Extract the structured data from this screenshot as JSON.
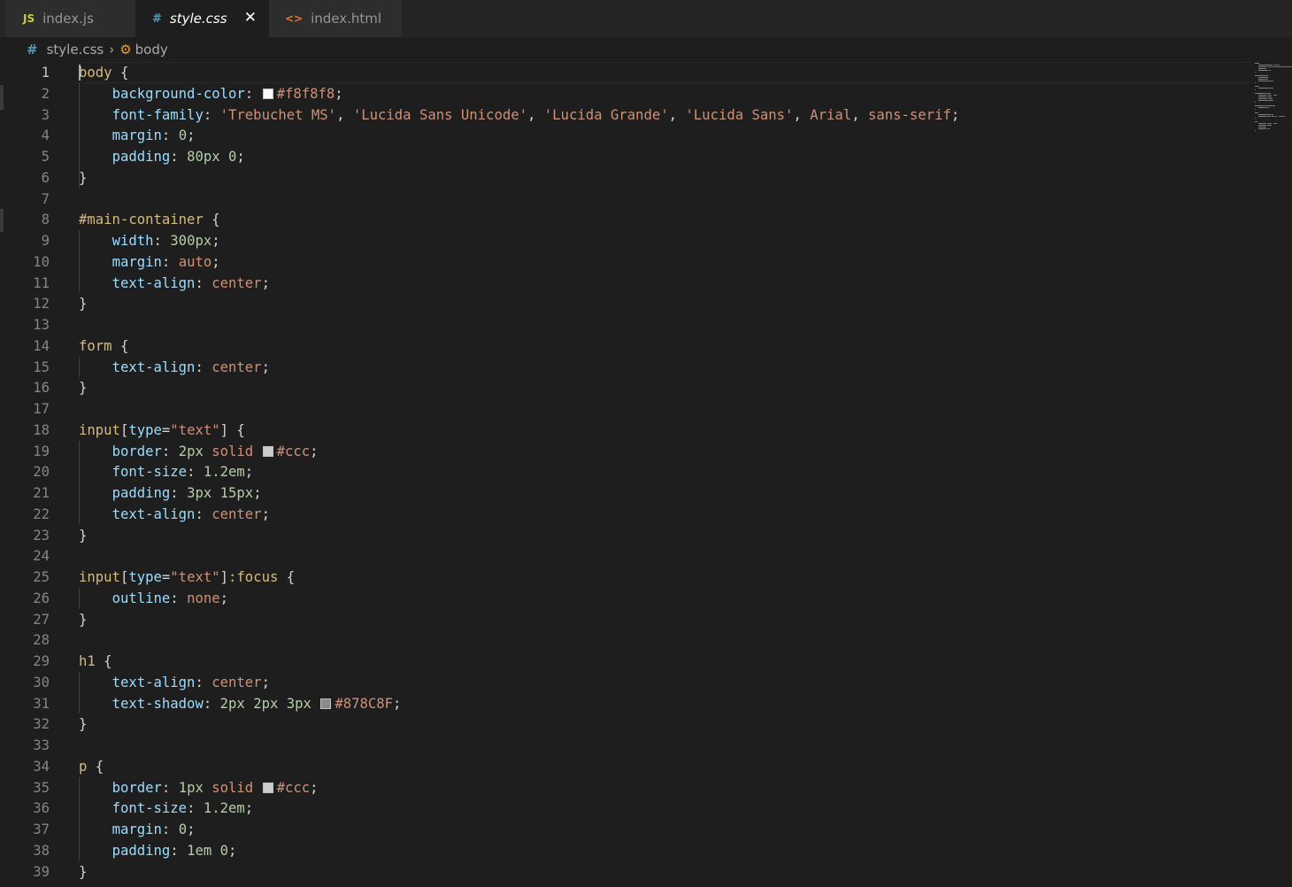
{
  "tabs": [
    {
      "label": "index.js",
      "icon": "JS",
      "icon_name": "javascript-file-icon",
      "active": false,
      "icon_color": "#cbcb41"
    },
    {
      "label": "style.css",
      "icon": "#",
      "icon_name": "css-file-icon",
      "active": true,
      "icon_color": "#519aba",
      "close": "✕"
    },
    {
      "label": "index.html",
      "icon": "<>",
      "icon_name": "html-file-icon",
      "active": false,
      "icon_color": "#e37933"
    }
  ],
  "breadcrumb": {
    "file_icon": "#",
    "file": "style.css",
    "separator": "›",
    "symbol_icon": "⚙",
    "symbol": "body"
  },
  "editor": {
    "language": "css",
    "current_line": 1,
    "lines": [
      {
        "n": "1",
        "tokens": [
          [
            "sel",
            "body"
          ],
          [
            "punc",
            " {"
          ]
        ]
      },
      {
        "n": "2",
        "tokens": [
          [
            "ind",
            "    "
          ],
          [
            "prop",
            "background-color"
          ],
          [
            "punc",
            ": "
          ],
          [
            "swatch",
            "#f8f8f8"
          ],
          [
            "val",
            "#f8f8f8"
          ],
          [
            "punc",
            ";"
          ]
        ]
      },
      {
        "n": "3",
        "tokens": [
          [
            "ind",
            "    "
          ],
          [
            "prop",
            "font-family"
          ],
          [
            "punc",
            ": "
          ],
          [
            "val",
            "'Trebuchet MS'"
          ],
          [
            "punc",
            ", "
          ],
          [
            "val",
            "'Lucida Sans Unicode'"
          ],
          [
            "punc",
            ", "
          ],
          [
            "val",
            "'Lucida Grande'"
          ],
          [
            "punc",
            ", "
          ],
          [
            "val",
            "'Lucida Sans'"
          ],
          [
            "punc",
            ", "
          ],
          [
            "val",
            "Arial"
          ],
          [
            "punc",
            ", "
          ],
          [
            "val",
            "sans-serif"
          ],
          [
            "punc",
            ";"
          ]
        ]
      },
      {
        "n": "4",
        "tokens": [
          [
            "ind",
            "    "
          ],
          [
            "prop",
            "margin"
          ],
          [
            "punc",
            ": "
          ],
          [
            "num",
            "0"
          ],
          [
            "punc",
            ";"
          ]
        ]
      },
      {
        "n": "5",
        "tokens": [
          [
            "ind",
            "    "
          ],
          [
            "prop",
            "padding"
          ],
          [
            "punc",
            ": "
          ],
          [
            "num",
            "80px"
          ],
          [
            "punc",
            " "
          ],
          [
            "num",
            "0"
          ],
          [
            "punc",
            ";"
          ]
        ]
      },
      {
        "n": "6",
        "tokens": [
          [
            "punc",
            "}"
          ]
        ]
      },
      {
        "n": "7",
        "tokens": []
      },
      {
        "n": "8",
        "tokens": [
          [
            "sel",
            "#main-container"
          ],
          [
            "punc",
            " {"
          ]
        ]
      },
      {
        "n": "9",
        "tokens": [
          [
            "ind",
            "    "
          ],
          [
            "prop",
            "width"
          ],
          [
            "punc",
            ": "
          ],
          [
            "num",
            "300px"
          ],
          [
            "punc",
            ";"
          ]
        ]
      },
      {
        "n": "10",
        "tokens": [
          [
            "ind",
            "    "
          ],
          [
            "prop",
            "margin"
          ],
          [
            "punc",
            ": "
          ],
          [
            "val",
            "auto"
          ],
          [
            "punc",
            ";"
          ]
        ]
      },
      {
        "n": "11",
        "tokens": [
          [
            "ind",
            "    "
          ],
          [
            "prop",
            "text-align"
          ],
          [
            "punc",
            ": "
          ],
          [
            "val",
            "center"
          ],
          [
            "punc",
            ";"
          ]
        ]
      },
      {
        "n": "12",
        "tokens": [
          [
            "punc",
            "}"
          ]
        ]
      },
      {
        "n": "13",
        "tokens": []
      },
      {
        "n": "14",
        "tokens": [
          [
            "sel",
            "form"
          ],
          [
            "punc",
            " {"
          ]
        ]
      },
      {
        "n": "15",
        "tokens": [
          [
            "ind",
            "    "
          ],
          [
            "prop",
            "text-align"
          ],
          [
            "punc",
            ": "
          ],
          [
            "val",
            "center"
          ],
          [
            "punc",
            ";"
          ]
        ]
      },
      {
        "n": "16",
        "tokens": [
          [
            "punc",
            "}"
          ]
        ]
      },
      {
        "n": "17",
        "tokens": []
      },
      {
        "n": "18",
        "tokens": [
          [
            "sel",
            "input"
          ],
          [
            "punc",
            "["
          ],
          [
            "prop",
            "type"
          ],
          [
            "punc",
            "="
          ],
          [
            "val",
            "\"text\""
          ],
          [
            "punc",
            "] {"
          ]
        ]
      },
      {
        "n": "19",
        "tokens": [
          [
            "ind",
            "    "
          ],
          [
            "prop",
            "border"
          ],
          [
            "punc",
            ": "
          ],
          [
            "num",
            "2px"
          ],
          [
            "punc",
            " "
          ],
          [
            "val",
            "solid"
          ],
          [
            "punc",
            " "
          ],
          [
            "swatch",
            "#cccccc"
          ],
          [
            "val",
            "#ccc"
          ],
          [
            "punc",
            ";"
          ]
        ]
      },
      {
        "n": "20",
        "tokens": [
          [
            "ind",
            "    "
          ],
          [
            "prop",
            "font-size"
          ],
          [
            "punc",
            ": "
          ],
          [
            "num",
            "1.2em"
          ],
          [
            "punc",
            ";"
          ]
        ]
      },
      {
        "n": "21",
        "tokens": [
          [
            "ind",
            "    "
          ],
          [
            "prop",
            "padding"
          ],
          [
            "punc",
            ": "
          ],
          [
            "num",
            "3px"
          ],
          [
            "punc",
            " "
          ],
          [
            "num",
            "15px"
          ],
          [
            "punc",
            ";"
          ]
        ]
      },
      {
        "n": "22",
        "tokens": [
          [
            "ind",
            "    "
          ],
          [
            "prop",
            "text-align"
          ],
          [
            "punc",
            ": "
          ],
          [
            "val",
            "center"
          ],
          [
            "punc",
            ";"
          ]
        ]
      },
      {
        "n": "23",
        "tokens": [
          [
            "punc",
            "}"
          ]
        ]
      },
      {
        "n": "24",
        "tokens": []
      },
      {
        "n": "25",
        "tokens": [
          [
            "sel",
            "input"
          ],
          [
            "punc",
            "["
          ],
          [
            "prop",
            "type"
          ],
          [
            "punc",
            "="
          ],
          [
            "val",
            "\"text\""
          ],
          [
            "punc",
            "]"
          ],
          [
            "sel",
            ":focus"
          ],
          [
            "punc",
            " {"
          ]
        ]
      },
      {
        "n": "26",
        "tokens": [
          [
            "ind",
            "    "
          ],
          [
            "prop",
            "outline"
          ],
          [
            "punc",
            ": "
          ],
          [
            "val",
            "none"
          ],
          [
            "punc",
            ";"
          ]
        ]
      },
      {
        "n": "27",
        "tokens": [
          [
            "punc",
            "}"
          ]
        ]
      },
      {
        "n": "28",
        "tokens": []
      },
      {
        "n": "29",
        "tokens": [
          [
            "sel",
            "h1"
          ],
          [
            "punc",
            " {"
          ]
        ]
      },
      {
        "n": "30",
        "tokens": [
          [
            "ind",
            "    "
          ],
          [
            "prop",
            "text-align"
          ],
          [
            "punc",
            ": "
          ],
          [
            "val",
            "center"
          ],
          [
            "punc",
            ";"
          ]
        ]
      },
      {
        "n": "31",
        "tokens": [
          [
            "ind",
            "    "
          ],
          [
            "prop",
            "text-shadow"
          ],
          [
            "punc",
            ": "
          ],
          [
            "num",
            "2px"
          ],
          [
            "punc",
            " "
          ],
          [
            "num",
            "2px"
          ],
          [
            "punc",
            " "
          ],
          [
            "num",
            "3px"
          ],
          [
            "punc",
            " "
          ],
          [
            "swatch",
            "#878C8F"
          ],
          [
            "val",
            "#878C8F"
          ],
          [
            "punc",
            ";"
          ]
        ]
      },
      {
        "n": "32",
        "tokens": [
          [
            "punc",
            "}"
          ]
        ]
      },
      {
        "n": "33",
        "tokens": []
      },
      {
        "n": "34",
        "tokens": [
          [
            "sel",
            "p"
          ],
          [
            "punc",
            " {"
          ]
        ]
      },
      {
        "n": "35",
        "tokens": [
          [
            "ind",
            "    "
          ],
          [
            "prop",
            "border"
          ],
          [
            "punc",
            ": "
          ],
          [
            "num",
            "1px"
          ],
          [
            "punc",
            " "
          ],
          [
            "val",
            "solid"
          ],
          [
            "punc",
            " "
          ],
          [
            "swatch",
            "#cccccc"
          ],
          [
            "val",
            "#ccc"
          ],
          [
            "punc",
            ";"
          ]
        ]
      },
      {
        "n": "36",
        "tokens": [
          [
            "ind",
            "    "
          ],
          [
            "prop",
            "font-size"
          ],
          [
            "punc",
            ": "
          ],
          [
            "num",
            "1.2em"
          ],
          [
            "punc",
            ";"
          ]
        ]
      },
      {
        "n": "37",
        "tokens": [
          [
            "ind",
            "    "
          ],
          [
            "prop",
            "margin"
          ],
          [
            "punc",
            ": "
          ],
          [
            "num",
            "0"
          ],
          [
            "punc",
            ";"
          ]
        ]
      },
      {
        "n": "38",
        "tokens": [
          [
            "ind",
            "    "
          ],
          [
            "prop",
            "padding"
          ],
          [
            "punc",
            ": "
          ],
          [
            "num",
            "1em"
          ],
          [
            "punc",
            " "
          ],
          [
            "num",
            "0"
          ],
          [
            "punc",
            ";"
          ]
        ]
      },
      {
        "n": "39",
        "tokens": [
          [
            "punc",
            "}"
          ]
        ]
      }
    ]
  },
  "colors": {
    "selector": "#d7ba7d",
    "property": "#9cdcfe",
    "number": "#b5cea8",
    "string_value": "#ce9178",
    "editor_bg": "#1e1e1e"
  }
}
